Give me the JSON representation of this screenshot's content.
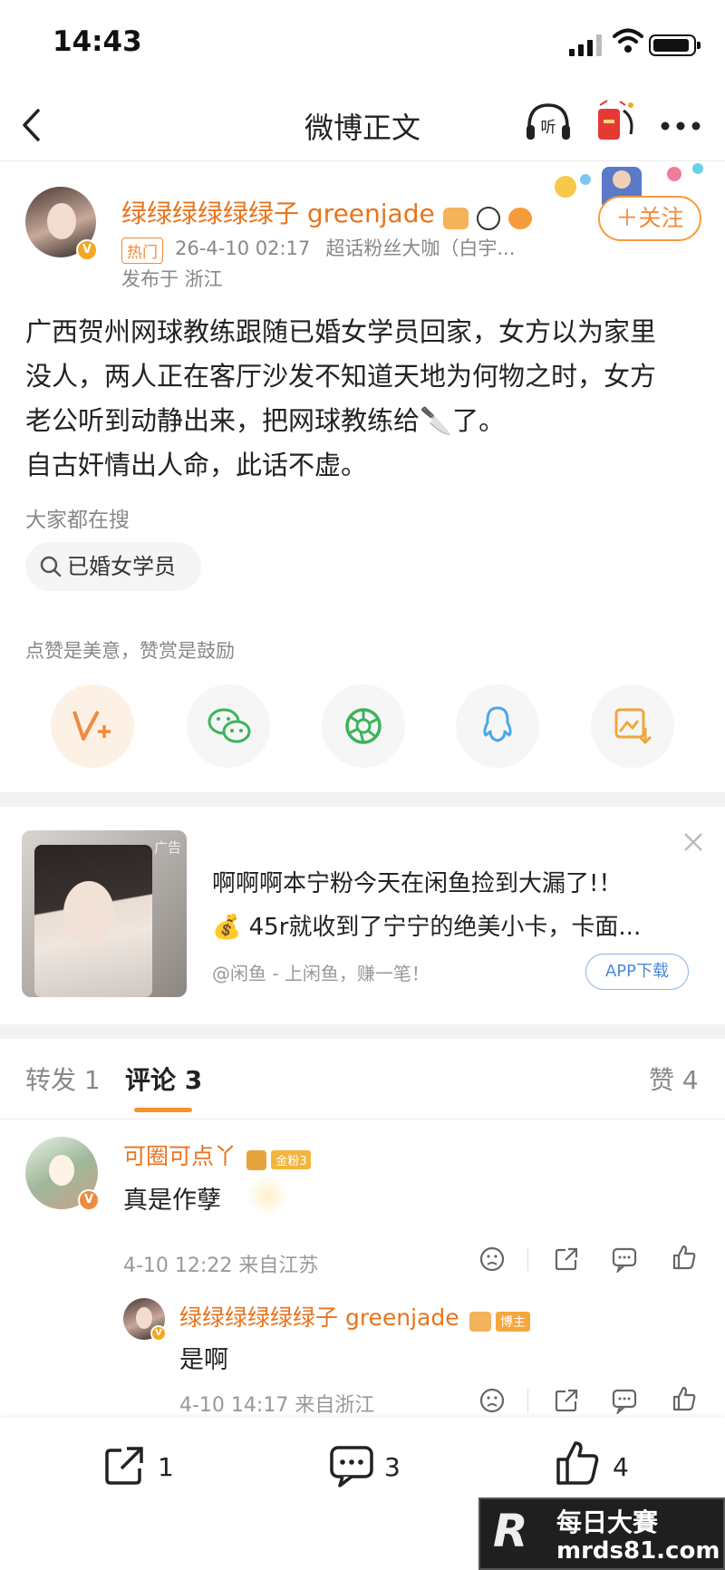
{
  "status_bar": {
    "time": "14:43"
  },
  "nav": {
    "title": "微博正文"
  },
  "post": {
    "author": "绿绿绿绿绿绿子 greenjade",
    "hot_tag": "热门",
    "timestamp": "26-4-10 02:17",
    "source": "超话粉丝大咖（白宇...",
    "location": "发布于 浙江",
    "follow_label": "＋关注",
    "body_lines": [
      "广西贺州网球教练跟随已婚女学员回家，女方以为家里",
      "没人，两人正在客厅沙发不知道天地为何物之时，女方",
      "老公听到动静出来，把网球教练给🔪了。",
      "自古奸情出人命，此话不虚。"
    ],
    "everyone_searching": "大家都在搜",
    "search_chip": "已婚女学员",
    "reward_text": "点赞是美意，赞赏是鼓励"
  },
  "ad": {
    "tag": "广告",
    "line1": "啊啊啊本宁粉今天在闲鱼捡到大漏了!！",
    "line2": "💰 45r就收到了宁宁的绝美小卡，卡面...",
    "source": "@闲鱼 - 上闲鱼，赚一笔！",
    "cta": "APP下载"
  },
  "tabs": {
    "repost": "转发 1",
    "comment": "评论 3",
    "like": "赞 4"
  },
  "comments": [
    {
      "user": "可圈可点丫",
      "badge": "金粉3",
      "text": "真是作孽",
      "meta": "4-10 12:22  来自江苏"
    },
    {
      "user": "绿绿绿绿绿绿子 greenjade",
      "badge": "博主",
      "text": "是啊",
      "meta": "4-10 14:17  来自浙江"
    }
  ],
  "bottom": {
    "repost_count": "1",
    "comment_count": "3",
    "like_count": "4"
  },
  "watermark": {
    "brand": "每日大賽",
    "url": "mrds81.com"
  },
  "colors": {
    "accent": "#e8741e",
    "link_blue": "#4a8ad8"
  }
}
